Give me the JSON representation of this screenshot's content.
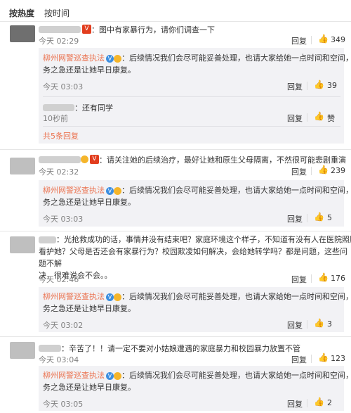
{
  "tabs": {
    "hot": "按热度",
    "time": "按时间"
  },
  "official_name": "柳州网警巡查执法",
  "official_reply": "：后续情况我们会尽可能妥善处理，也请大家给她一点时间和空间，当务之急还是让她早日康复。",
  "official_reply_l1": "：后续情况我们会尽可能妥善处理，也请大家给她一点时间和空间，当",
  "official_reply_l2": "务之急还是让她早日康复。",
  "labels": {
    "reply": "回复",
    "like": "赞"
  },
  "comments": [
    {
      "text": "：图中有家暴行为，请你们调查一下",
      "time": "今天 02:29",
      "likes": "349",
      "official_time": "今天 03:03",
      "official_likes": "39",
      "sub_reply": {
        "text": "：还有同学",
        "time": "10秒前"
      },
      "more": "共5条回复"
    },
    {
      "text": "：请关注她的后续治疗，最好让她和原生父母隔离，不然很可能悲剧重演",
      "time": "今天 02:32",
      "likes": "239",
      "official_time": "今天 03:03",
      "official_likes": "5"
    },
    {
      "text_l1": "：光抢救成功的话，事情并没有结束吧？家庭环境这个样子，不知道有没有人在医院照顾",
      "text_l2": "看护她？父母是否还会有家暴行为？校园欺凌如何解决，会给她转学吗？都是问题，这些问题不解",
      "text_l3": "决，很难说会不会。。",
      "time": "今天 02:46",
      "likes": "176",
      "official_time": "今天 03:02",
      "official_likes": "3"
    },
    {
      "text": "：辛苦了！！请一定不要对小姑娘遭遇的家庭暴力和校园暴力放置不管",
      "time": "今天 03:04",
      "likes": "123",
      "official_time": "今天 03:05",
      "official_likes": "2"
    }
  ]
}
